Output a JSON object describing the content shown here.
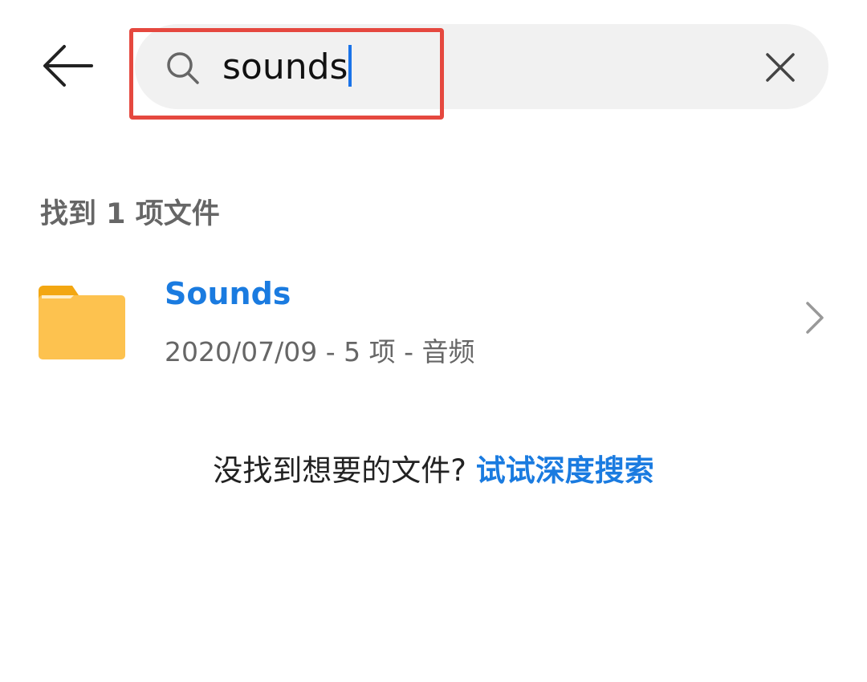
{
  "header": {
    "back_icon": "arrow-left-icon",
    "search_icon": "search-icon",
    "query": "sounds",
    "clear_icon": "close-icon",
    "highlight_color": "#e5483f"
  },
  "results": {
    "count_label": "找到 1 项文件",
    "items": [
      {
        "name": "Sounds",
        "meta": "2020/07/09 - 5 项 - 音频",
        "icon": "folder-icon"
      }
    ]
  },
  "footer": {
    "prompt": "没找到想要的文件?",
    "link": "试试深度搜索"
  },
  "colors": {
    "accent": "#1a7be0",
    "folder": "#fdc24f"
  }
}
